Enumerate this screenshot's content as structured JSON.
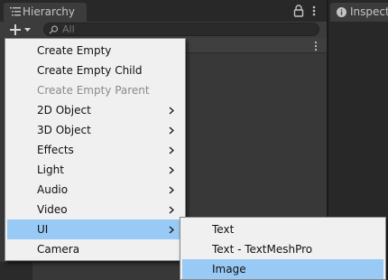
{
  "hierarchy": {
    "tab_label": "Hierarchy",
    "search": {
      "placeholder": "All",
      "value": ""
    }
  },
  "inspector": {
    "tab_label": "Inspector"
  },
  "create_menu": {
    "items": [
      {
        "label": "Create Empty",
        "enabled": true,
        "has_submenu": false
      },
      {
        "label": "Create Empty Child",
        "enabled": true,
        "has_submenu": false
      },
      {
        "label": "Create Empty Parent",
        "enabled": false,
        "has_submenu": false
      },
      {
        "label": "2D Object",
        "enabled": true,
        "has_submenu": true
      },
      {
        "label": "3D Object",
        "enabled": true,
        "has_submenu": true
      },
      {
        "label": "Effects",
        "enabled": true,
        "has_submenu": true
      },
      {
        "label": "Light",
        "enabled": true,
        "has_submenu": true
      },
      {
        "label": "Audio",
        "enabled": true,
        "has_submenu": true
      },
      {
        "label": "Video",
        "enabled": true,
        "has_submenu": true
      },
      {
        "label": "UI",
        "enabled": true,
        "has_submenu": true,
        "highlighted": true
      },
      {
        "label": "Camera",
        "enabled": true,
        "has_submenu": false
      }
    ]
  },
  "ui_submenu": {
    "items": [
      {
        "label": "Text"
      },
      {
        "label": "Text - TextMeshPro"
      },
      {
        "label": "Image",
        "highlighted": true
      }
    ]
  },
  "icons": {
    "hierarchy_tab": "list-icon",
    "inspector_tab": "info-icon",
    "lock": "lock-icon",
    "more": "vertical-dots-icon",
    "add": "plus-dropdown-icon",
    "search": "search-icon",
    "submenu": "chevron-right-icon"
  },
  "colors": {
    "highlight": "#99c9f5",
    "menu_background": "#f0f0f0",
    "panel_background": "#383838",
    "disabled_text": "#8a8a8a"
  }
}
